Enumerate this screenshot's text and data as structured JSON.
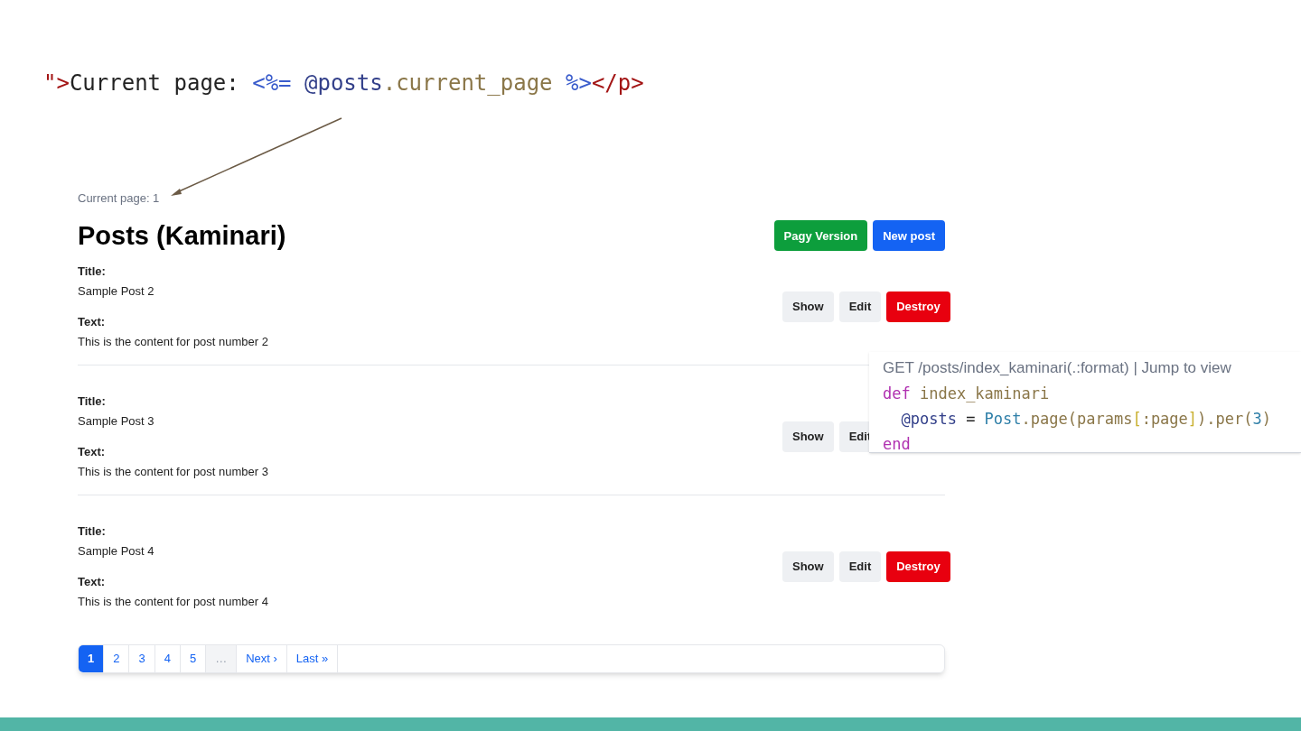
{
  "code_snippet": [
    {
      "text": "\">",
      "kind": "tag"
    },
    {
      "text": "Current page: ",
      "kind": "plain"
    },
    {
      "text": "<%=",
      "kind": "erb"
    },
    {
      "text": " @posts",
      "kind": "ivar"
    },
    {
      "text": ".current_page",
      "kind": "method"
    },
    {
      "text": " %>",
      "kind": "erb"
    },
    {
      "text": "</p>",
      "kind": "tag"
    }
  ],
  "current_page_label": "Current page: 1",
  "heading": "Posts (Kaminari)",
  "header_buttons": [
    {
      "label": "Pagy Version",
      "kind": "success"
    },
    {
      "label": "New post",
      "kind": "primary"
    }
  ],
  "posts": [
    {
      "title_label": "Title:",
      "title": "Sample Post 2",
      "text_label": "Text:",
      "text": "This is the content for post number 2",
      "buttons": [
        {
          "label": "Show",
          "kind": "light"
        },
        {
          "label": "Edit",
          "kind": "light"
        },
        {
          "label": "Destroy",
          "kind": "danger"
        }
      ]
    },
    {
      "title_label": "Title:",
      "title": "Sample Post 3",
      "text_label": "Text:",
      "text": "This is the content for post number 3",
      "buttons": [
        {
          "label": "Show",
          "kind": "light"
        },
        {
          "label": "Edit",
          "kind": "light"
        }
      ]
    },
    {
      "title_label": "Title:",
      "title": "Sample Post 4",
      "text_label": "Text:",
      "text": "This is the content for post number 4",
      "buttons": [
        {
          "label": "Show",
          "kind": "light"
        },
        {
          "label": "Edit",
          "kind": "light"
        },
        {
          "label": "Destroy",
          "kind": "danger"
        }
      ]
    }
  ],
  "pagination": [
    {
      "label": "1",
      "kind": "page",
      "selected": true
    },
    {
      "label": "2",
      "kind": "page",
      "selected": false
    },
    {
      "label": "3",
      "kind": "page",
      "selected": false
    },
    {
      "label": "4",
      "kind": "page",
      "selected": false
    },
    {
      "label": "5",
      "kind": "page",
      "selected": false
    },
    {
      "label": "…",
      "kind": "gap",
      "selected": false
    },
    {
      "label": "Next ›",
      "kind": "page",
      "selected": false
    },
    {
      "label": "Last »",
      "kind": "page",
      "selected": false
    }
  ],
  "code_popup": {
    "route": "GET /posts/index_kaminari(.:format) | Jump to view",
    "lines": [
      [
        {
          "text": "def",
          "kind": "keyword"
        },
        {
          "text": " index_kaminari",
          "kind": "method"
        }
      ],
      [
        {
          "text": "  @posts",
          "kind": "ivar"
        },
        {
          "text": " = ",
          "kind": "plain"
        },
        {
          "text": "Post",
          "kind": "const"
        },
        {
          "text": ".page(params",
          "kind": "method"
        },
        {
          "text": "[",
          "kind": "bracket"
        },
        {
          "text": ":page",
          "kind": "method"
        },
        {
          "text": "]",
          "kind": "bracket"
        },
        {
          "text": ").per(",
          "kind": "method"
        },
        {
          "text": "3",
          "kind": "number"
        },
        {
          "text": ")",
          "kind": "method"
        }
      ],
      [
        {
          "text": "end",
          "kind": "keyword"
        }
      ]
    ]
  }
}
